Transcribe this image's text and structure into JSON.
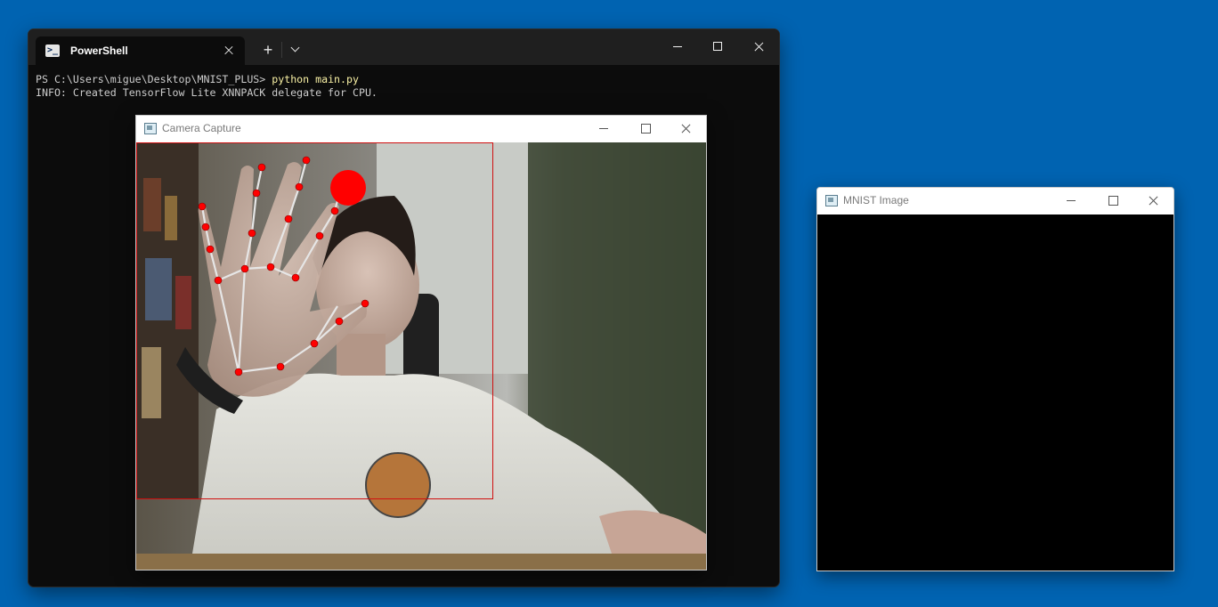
{
  "terminal": {
    "tab_title": "PowerShell",
    "prompt": "PS C:\\Users\\migue\\Desktop\\MNIST_PLUS> ",
    "command": "python main.py",
    "output_line": "INFO: Created TensorFlow Lite XNNPACK delegate for CPU."
  },
  "camera_window": {
    "title": "Camera Capture"
  },
  "mnist_window": {
    "title": "MNIST Image"
  },
  "colors": {
    "desktop": "#0063b1",
    "landmark": "#ff0000",
    "connector": "#e6e6e6",
    "roi_box": "#d01010"
  }
}
